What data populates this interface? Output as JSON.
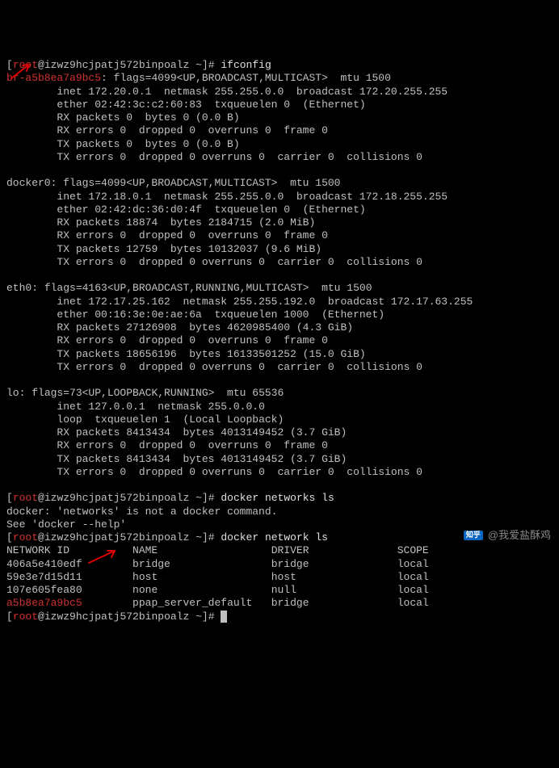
{
  "prompt": {
    "user": "root",
    "host": "izwz9hcjpatj572binpoalz",
    "path": "~",
    "symbol": "#"
  },
  "cmd1": "ifconfig",
  "if_br": {
    "name": "br-a5b8ea7a9bc5",
    "flags": "flags=4099<UP,BROADCAST,MULTICAST>  mtu 1500",
    "inet": "inet 172.20.0.1  netmask 255.255.0.0  broadcast 172.20.255.255",
    "ether": "ether 02:42:3c:c2:60:83  txqueuelen 0  (Ethernet)",
    "rxp": "RX packets 0  bytes 0 (0.0 B)",
    "rxe": "RX errors 0  dropped 0  overruns 0  frame 0",
    "txp": "TX packets 0  bytes 0 (0.0 B)",
    "txe": "TX errors 0  dropped 0 overruns 0  carrier 0  collisions 0"
  },
  "if_docker0": {
    "name": "docker0",
    "flags": "flags=4099<UP,BROADCAST,MULTICAST>  mtu 1500",
    "inet": "inet 172.18.0.1  netmask 255.255.0.0  broadcast 172.18.255.255",
    "ether": "ether 02:42:dc:36:d0:4f  txqueuelen 0  (Ethernet)",
    "rxp": "RX packets 18874  bytes 2184715 (2.0 MiB)",
    "rxe": "RX errors 0  dropped 0  overruns 0  frame 0",
    "txp": "TX packets 12759  bytes 10132037 (9.6 MiB)",
    "txe": "TX errors 0  dropped 0 overruns 0  carrier 0  collisions 0"
  },
  "if_eth0": {
    "name": "eth0",
    "flags": "flags=4163<UP,BROADCAST,RUNNING,MULTICAST>  mtu 1500",
    "inet": "inet 172.17.25.162  netmask 255.255.192.0  broadcast 172.17.63.255",
    "ether": "ether 00:16:3e:0e:ae:6a  txqueuelen 1000  (Ethernet)",
    "rxp": "RX packets 27126908  bytes 4620985400 (4.3 GiB)",
    "rxe": "RX errors 0  dropped 0  overruns 0  frame 0",
    "txp": "TX packets 18656196  bytes 16133501252 (15.0 GiB)",
    "txe": "TX errors 0  dropped 0 overruns 0  carrier 0  collisions 0"
  },
  "if_lo": {
    "name": "lo",
    "flags": "flags=73<UP,LOOPBACK,RUNNING>  mtu 65536",
    "inet": "inet 127.0.0.1  netmask 255.0.0.0",
    "loop": "loop  txqueuelen 1  (Local Loopback)",
    "rxp": "RX packets 8413434  bytes 4013149452 (3.7 GiB)",
    "rxe": "RX errors 0  dropped 0  overruns 0  frame 0",
    "txp": "TX packets 8413434  bytes 4013149452 (3.7 GiB)",
    "txe": "TX errors 0  dropped 0 overruns 0  carrier 0  collisions 0"
  },
  "cmd2": "docker networks ls",
  "err1": "docker: 'networks' is not a docker command.",
  "err2": "See 'docker --help'",
  "cmd3": "docker network ls",
  "nethdr": {
    "id": "NETWORK ID",
    "name": "NAME",
    "driver": "DRIVER",
    "scope": "SCOPE"
  },
  "netrows": [
    {
      "id": "406a5e410edf",
      "name": "bridge",
      "driver": "bridge",
      "scope": "local"
    },
    {
      "id": "59e3e7d15d11",
      "name": "host",
      "driver": "host",
      "scope": "local"
    },
    {
      "id": "107e605fea80",
      "name": "none",
      "driver": "null",
      "scope": "local"
    },
    {
      "id": "a5b8ea7a9bc5",
      "name": "ppap_server_default",
      "driver": "bridge",
      "scope": "local"
    }
  ],
  "watermark": "我爱盐酥鸡",
  "zhihu": "知乎"
}
